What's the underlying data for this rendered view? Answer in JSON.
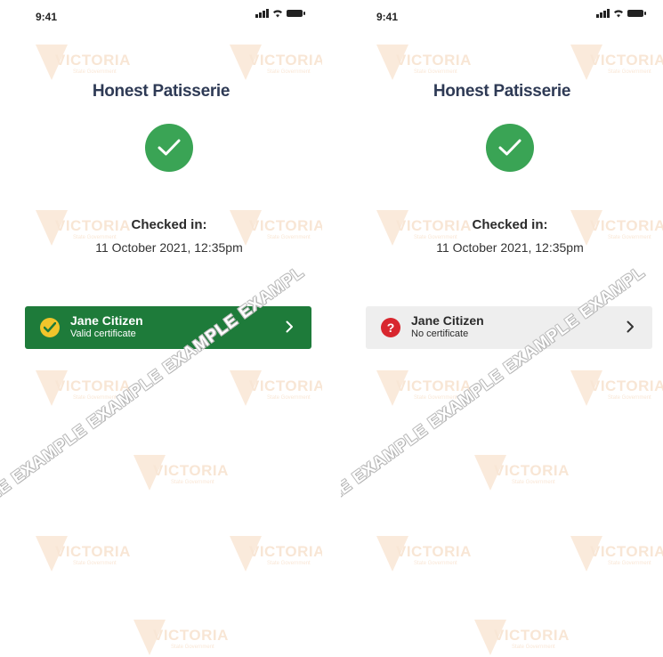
{
  "screens": [
    {
      "status": {
        "time": "9:41"
      },
      "venue": "Honest Patisserie",
      "checked_in_label": "Checked in:",
      "checked_in_date": "11 October 2021, 12:35pm",
      "person": {
        "name": "Jane Citizen",
        "certificate": "Valid certificate",
        "state": "valid"
      }
    },
    {
      "status": {
        "time": "9:41"
      },
      "venue": "Honest Patisserie",
      "checked_in_label": "Checked in:",
      "checked_in_date": "11 October 2021, 12:35pm",
      "person": {
        "name": "Jane Citizen",
        "certificate": "No certificate",
        "state": "none",
        "badge": "?"
      }
    }
  ],
  "watermark": {
    "diagonal_text": "LE EXAMPLE EXAMPLE EXAMPLE EXAMPL",
    "logo_word": "VICTORIA",
    "logo_sub": "State Government"
  },
  "colors": {
    "success": "#3aa455",
    "valid_card": "#1e7b3a",
    "invalid_badge": "#d8262e",
    "venue_text": "#2e3a55"
  },
  "icons": {
    "check": "check-icon",
    "chevron": "chevron-right-icon",
    "signal": "signal-icon",
    "wifi": "wifi-icon",
    "battery": "battery-icon"
  }
}
